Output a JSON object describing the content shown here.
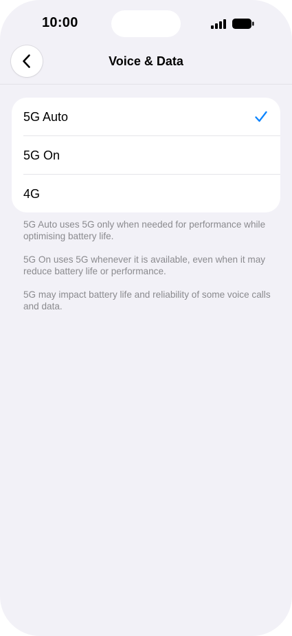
{
  "status_bar": {
    "time": "10:00"
  },
  "nav": {
    "title": "Voice & Data",
    "back_icon": "chevron-left-icon"
  },
  "options": [
    {
      "label": "5G Auto",
      "selected": true
    },
    {
      "label": "5G On",
      "selected": false
    },
    {
      "label": "4G",
      "selected": false
    }
  ],
  "footnotes": [
    "5G Auto uses 5G only when needed for performance while optimising battery life.",
    "5G On uses 5G whenever it is available, even when it may reduce battery life or performance.",
    "5G may impact battery life and reliability of some voice calls and data."
  ],
  "colors": {
    "background": "#f2f1f7",
    "card": "#ffffff",
    "accent": "#0a84ff",
    "secondary_text": "#8a8a8e"
  }
}
